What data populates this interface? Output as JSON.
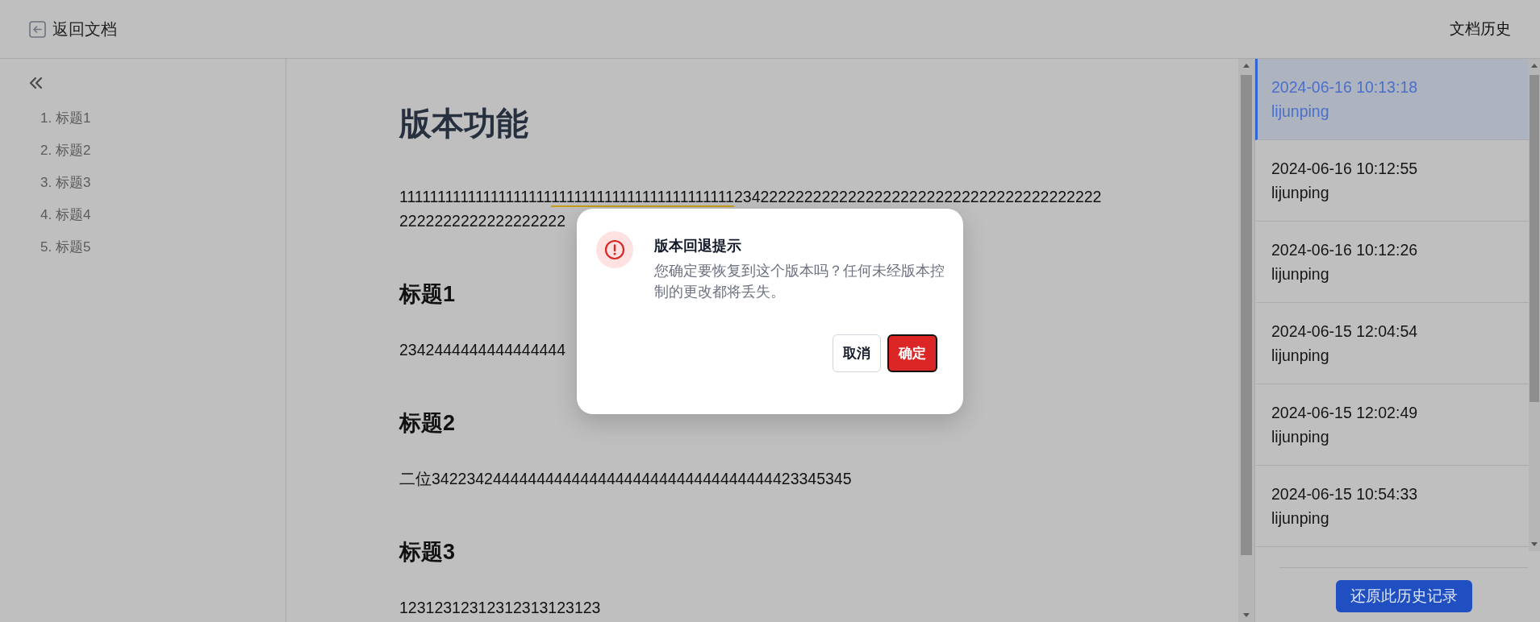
{
  "header": {
    "back_link": "返回文档",
    "title": "文档历史"
  },
  "outline": {
    "items": [
      "1. 标题1",
      "2. 标题2",
      "3. 标题3",
      "4. 标题4",
      "5. 标题5"
    ]
  },
  "document": {
    "title": "版本功能",
    "blocks": [
      {
        "kind": "paragraph",
        "lines": [
          [
            {
              "text": "11111111111111111111",
              "underlined": false
            },
            {
              "text": "111111111111111111111111",
              "underlined": true
            },
            {
              "text": "234222222222222222222222222222222222222222",
              "underlined": false
            }
          ],
          [
            {
              "text": "2222222222222222222",
              "underlined": false
            }
          ]
        ]
      },
      {
        "kind": "heading",
        "text": "标题1"
      },
      {
        "kind": "paragraph",
        "lines": [
          [
            {
              "text": "2342444444444444444",
              "underlined": false
            }
          ]
        ]
      },
      {
        "kind": "heading",
        "text": "标题2"
      },
      {
        "kind": "paragraph",
        "lines": [
          [
            {
              "text": "二位342234244444444444444444444444444444444423345345",
              "underlined": false
            }
          ]
        ]
      },
      {
        "kind": "heading",
        "text": "标题3"
      },
      {
        "kind": "paragraph",
        "lines": [
          [
            {
              "text": "12312312312312313123123",
              "underlined": false
            }
          ]
        ]
      }
    ]
  },
  "history": {
    "items": [
      {
        "time": "2024-06-16 10:13:18",
        "user": "lijunping",
        "selected": true
      },
      {
        "time": "2024-06-16 10:12:55",
        "user": "lijunping",
        "selected": false
      },
      {
        "time": "2024-06-16 10:12:26",
        "user": "lijunping",
        "selected": false
      },
      {
        "time": "2024-06-15 12:04:54",
        "user": "lijunping",
        "selected": false
      },
      {
        "time": "2024-06-15 12:02:49",
        "user": "lijunping",
        "selected": false
      },
      {
        "time": "2024-06-15 10:54:33",
        "user": "lijunping",
        "selected": false
      }
    ],
    "restore_button": "还原此历史记录"
  },
  "dialog": {
    "title": "版本回退提示",
    "message": "您确定要恢复到这个版本吗？任何未经版本控制的更改都将丢失。",
    "buttons": [
      {
        "label": "取消",
        "kind": "secondary"
      },
      {
        "label": "确定",
        "kind": "danger"
      }
    ]
  }
}
